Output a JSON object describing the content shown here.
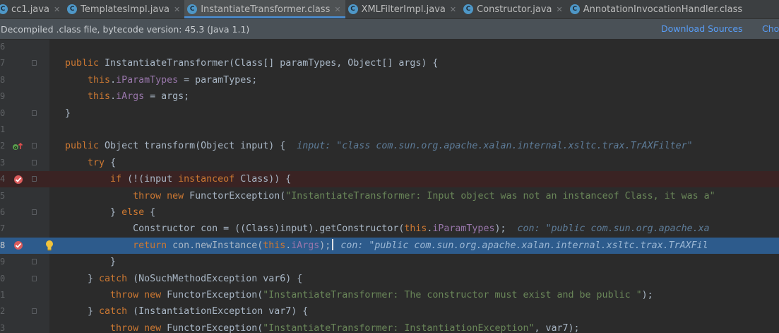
{
  "tabs": [
    {
      "label": "cc1.java",
      "active": false,
      "icon": "java-class-icon"
    },
    {
      "label": "TemplatesImpl.java",
      "active": false,
      "icon": "java-class-icon"
    },
    {
      "label": "InstantiateTransformer.class",
      "active": true,
      "icon": "class-file-icon"
    },
    {
      "label": "XMLFilterImpl.java",
      "active": false,
      "icon": "java-class-icon"
    },
    {
      "label": "Constructor.java",
      "active": false,
      "icon": "java-class-icon"
    },
    {
      "label": "AnnotationInvocationHandler.class",
      "active": false,
      "icon": "class-file-icon"
    }
  ],
  "banner": {
    "text": "Decompiled .class file, bytecode version: 45.3 (Java 1.1)",
    "download_label": "Download Sources",
    "choose_label": "Cho"
  },
  "lines": [
    {
      "num": "6"
    },
    {
      "num": "7",
      "fold": true
    },
    {
      "num": "8"
    },
    {
      "num": "9"
    },
    {
      "num": "0",
      "fold": true
    },
    {
      "num": "1"
    },
    {
      "num": "2",
      "fold": true,
      "marker": "override"
    },
    {
      "num": "3",
      "fold": true
    },
    {
      "num": "4",
      "fold": true,
      "marker": "breakpoint",
      "bp": true
    },
    {
      "num": "5"
    },
    {
      "num": "6",
      "fold": true
    },
    {
      "num": "7"
    },
    {
      "num": "8",
      "marker": "breakpoint",
      "current": true
    },
    {
      "num": "9",
      "fold": true
    },
    {
      "num": "0",
      "fold": true
    },
    {
      "num": "1"
    },
    {
      "num": "2",
      "fold": true
    },
    {
      "num": "3"
    }
  ],
  "code_tokens": [
    {
      "indent": "",
      "kw1": "",
      "txt1": "",
      "kw2": "",
      "txt2": "",
      "str": "",
      "txt3": "",
      "fld": "",
      "txt4": "",
      "hint": ""
    },
    {
      "kw1": "public",
      "txt1": " InstantiateTransformer(Class[] paramTypes, Object[] args) {"
    },
    {
      "kw1": "this",
      "fld": "iParamTypes",
      "txt4": " = paramTypes;"
    },
    {
      "kw1": "this",
      "fld": "iArgs",
      "txt4": " = args;"
    },
    {
      "txt1": "}"
    },
    {},
    {
      "kw1": "public",
      "txt1": " Object transform(Object input) {",
      "hint": "input: \"class com.sun.org.apache.xalan.internal.xsltc.trax.TrAXFilter\""
    },
    {
      "kw1": "try",
      "txt1": " {"
    },
    {
      "kw1": "if",
      "txt1": " (!(input ",
      "kw2": "instanceof",
      "txt2": " Class)) {"
    },
    {
      "kw1": "throw",
      "kw2": "new",
      "txt2": " FunctorException(",
      "str": "\"InstantiateTransformer: Input object was not an instanceof Class, it was a\""
    },
    {
      "txt1": "} ",
      "kw2": "else",
      "txt2": " {"
    },
    {
      "txt1": "Constructor con = ((Class)input).getConstructor(",
      "kw2": "this",
      "fld": "iParamTypes",
      "txt4": ");",
      "hint": "con: \"public com.sun.org.apache.xa"
    },
    {
      "kw1": "return",
      "txt1": " con.newInstance(",
      "kw2": "this",
      "fld": "iArgs",
      "txt4": ");",
      "hint": "con: \"public com.sun.org.apache.xalan.internal.xsltc.trax.TrAXFil"
    },
    {
      "txt1": "}"
    },
    {
      "txt1": "} ",
      "kw2": "catch",
      "txt2": " (NoSuchMethodException var6) {"
    },
    {
      "kw1": "throw",
      "kw2": "new",
      "txt2": " FunctorException(",
      "str": "\"InstantiateTransformer: The constructor must exist and be public \"",
      "txt3": ");"
    },
    {
      "txt1": "} ",
      "kw2": "catch",
      "txt2": " (InstantiationException var7) {"
    },
    {
      "kw1": "throw",
      "kw2": "new",
      "txt2": " FunctorException(",
      "str": "\"InstantiateTransformer: InstantiationException\"",
      "txt3": ", var7);"
    }
  ],
  "colors": {
    "keyword": "#cc7832",
    "string": "#6a8759",
    "field": "#9876aa",
    "hint": "#5e7d9a",
    "current_line": "#2d5b8c",
    "breakpoint_line": "#3a2323",
    "breakpoint": "#db5c5c",
    "tab_underline": "#4a88c7",
    "link": "#589df6"
  }
}
